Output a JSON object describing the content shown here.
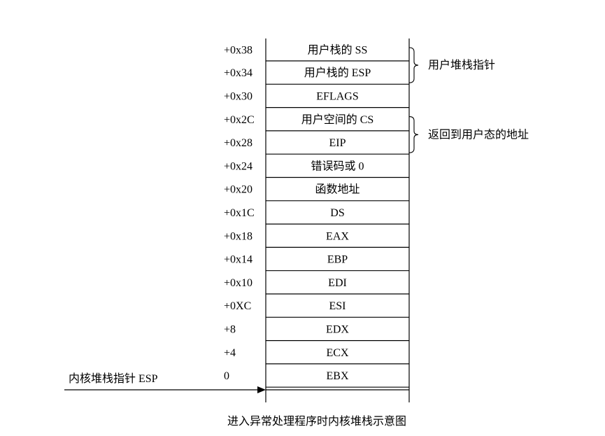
{
  "stack": {
    "rows": [
      {
        "offset": "+0x38",
        "label": "用户栈的 SS"
      },
      {
        "offset": "+0x34",
        "label": "用户栈的 ESP"
      },
      {
        "offset": "+0x30",
        "label": "EFLAGS"
      },
      {
        "offset": "+0x2C",
        "label": "用户空间的 CS"
      },
      {
        "offset": "+0x28",
        "label": "EIP"
      },
      {
        "offset": "+0x24",
        "label": "错误码或 0"
      },
      {
        "offset": "+0x20",
        "label": "函数地址"
      },
      {
        "offset": "+0x1C",
        "label": "DS"
      },
      {
        "offset": "+0x18",
        "label": "EAX"
      },
      {
        "offset": "+0x14",
        "label": "EBP"
      },
      {
        "offset": "+0x10",
        "label": "EDI"
      },
      {
        "offset": "+0XC",
        "label": "ESI"
      },
      {
        "offset": "+8",
        "label": "EDX"
      },
      {
        "offset": "+4",
        "label": "ECX"
      },
      {
        "offset": "0",
        "label": "EBX"
      }
    ]
  },
  "braces": [
    {
      "label": "用户堆栈指针",
      "from_row": 0,
      "to_row": 1
    },
    {
      "label": "返回到用户态的地址",
      "from_row": 3,
      "to_row": 4
    }
  ],
  "pointer": {
    "label": "内核堆栈指针 ESP",
    "target_row": 14
  },
  "caption": "进入异常处理程序时内核堆栈示意图"
}
